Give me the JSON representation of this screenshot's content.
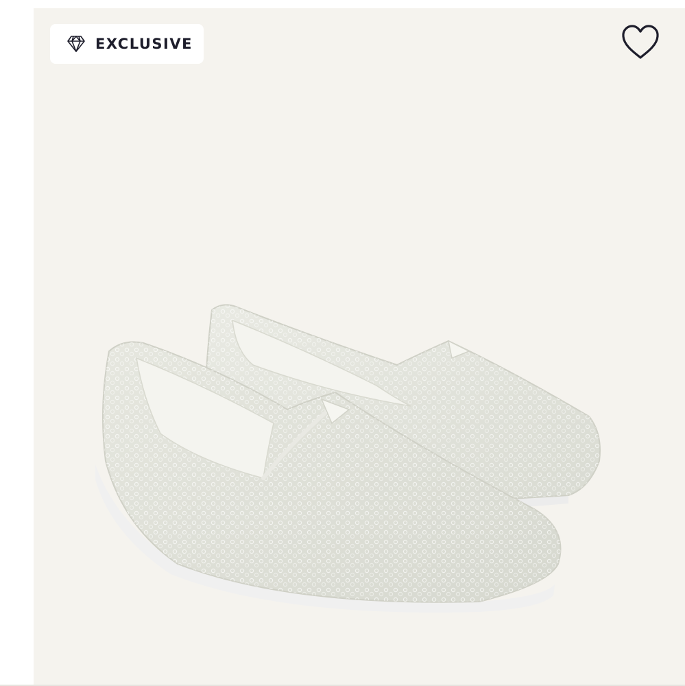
{
  "product_card": {
    "badge": {
      "label": "EXCLUSIVE",
      "icon": "diamond-icon"
    },
    "wishlist": {
      "icon": "heart-outline-icon"
    },
    "image": {
      "subject": "sequin-slip-on-shoes"
    }
  },
  "colors": {
    "card_background": "#f5f3ee",
    "badge_background": "#ffffff",
    "badge_text": "#1d1d2b",
    "heart_stroke": "#1d1d2b",
    "shoe_fabric": "#e3e4dc",
    "shoe_sole": "#f1f1f1"
  }
}
